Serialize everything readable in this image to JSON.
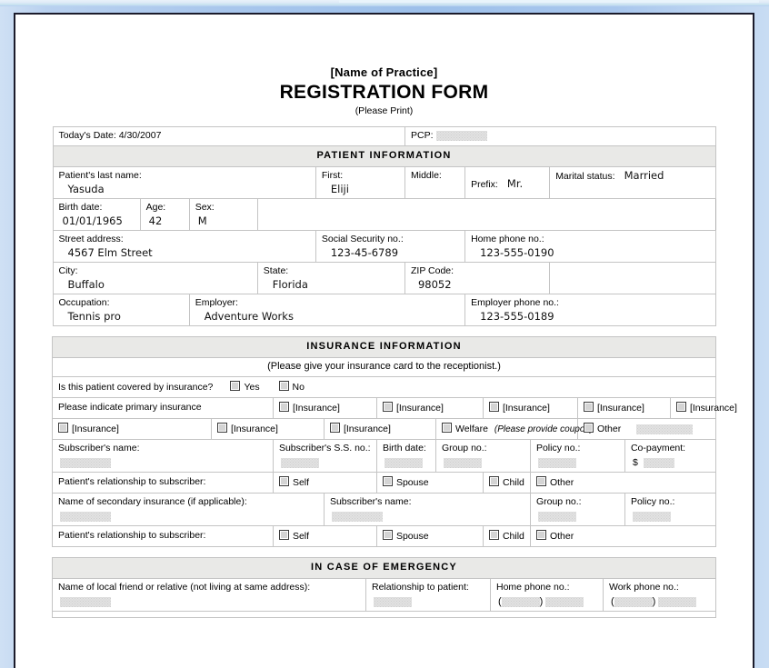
{
  "document": {
    "practice_name": "[Name of Practice]",
    "form_title": "REGISTRATION FORM",
    "please_print": "(Please Print)"
  },
  "header_row": {
    "todays_date_label": "Today's Date: 4/30/2007",
    "pcp_label": "PCP:"
  },
  "patient_information": {
    "section_title": "PATIENT INFORMATION",
    "last_name_label": "Patient's last name:",
    "last_name_value": "Yasuda",
    "first_label": "First:",
    "first_value": "Eliji",
    "middle_label": "Middle:",
    "middle_value": "",
    "prefix_label": "Prefix:",
    "prefix_value": "Mr.",
    "marital_status_label": "Marital status:",
    "marital_status_value": "Married",
    "birth_date_label": "Birth date:",
    "birth_date_value": "01/01/1965",
    "age_label": "Age:",
    "age_value": "42",
    "sex_label": "Sex:",
    "sex_value": "M",
    "street_address_label": "Street address:",
    "street_address_value": "4567 Elm Street",
    "ssn_label": "Social Security no.:",
    "ssn_value": "123-45-6789",
    "home_phone_label": "Home phone no.:",
    "home_phone_value": "123-555-0190",
    "city_label": "City:",
    "city_value": "Buffalo",
    "state_label": "State:",
    "state_value": "Florida",
    "zip_label": "ZIP Code:",
    "zip_value": "98052",
    "occupation_label": "Occupation:",
    "occupation_value": "Tennis pro",
    "employer_label": "Employer:",
    "employer_value": "Adventure Works",
    "employer_phone_label": "Employer phone no.:",
    "employer_phone_value": "123-555-0189"
  },
  "insurance_information": {
    "section_title": "INSURANCE INFORMATION",
    "subnote": "(Please give your insurance card to the receptionist.)",
    "covered_question": "Is this patient covered by insurance?",
    "covered_yes": "Yes",
    "covered_no": "No",
    "primary_label": "Please indicate primary insurance",
    "insurance_option": "[Insurance]",
    "primary_row1": [
      "[Insurance]",
      "[Insurance]",
      "[Insurance]",
      "[Insurance]",
      "[Insurance]"
    ],
    "primary_row2": [
      "[Insurance]",
      "[Insurance]",
      "[Insurance]"
    ],
    "welfare_label": "Welfare",
    "welfare_note": "(Please provide coupon)",
    "other_label": "Other",
    "subscriber_name_label": "Subscriber's name:",
    "subscriber_ssn_label": "Subscriber's S.S. no.:",
    "subscriber_birth_label": "Birth date:",
    "group_no_label": "Group no.:",
    "policy_no_label": "Policy no.:",
    "copayment_label": "Co-payment:",
    "copayment_currency": "$",
    "relationship_label": "Patient's relationship to subscriber:",
    "rel_self": "Self",
    "rel_spouse": "Spouse",
    "rel_child": "Child",
    "rel_other": "Other",
    "secondary_name_label": "Name of secondary insurance (if applicable):",
    "secondary_subscriber_label": "Subscriber's name:",
    "secondary_group_label": "Group no.:",
    "secondary_policy_label": "Policy no.:",
    "relationship_label2": "Patient's relationship to subscriber:"
  },
  "emergency": {
    "section_title": "IN CASE OF EMERGENCY",
    "local_friend_label": "Name of local friend or relative (not living at same address):",
    "relationship_label": "Relationship to patient:",
    "home_phone_label": "Home phone no.:",
    "work_phone_label": "Work phone no.:",
    "paren_open": "(",
    "paren_close": ")"
  },
  "colors": {
    "frame_blue": "#a8c6ec",
    "section_header_bg": "#e9e9e7",
    "border": "#c4c4c4",
    "placeholder": "#e2e2e2"
  }
}
